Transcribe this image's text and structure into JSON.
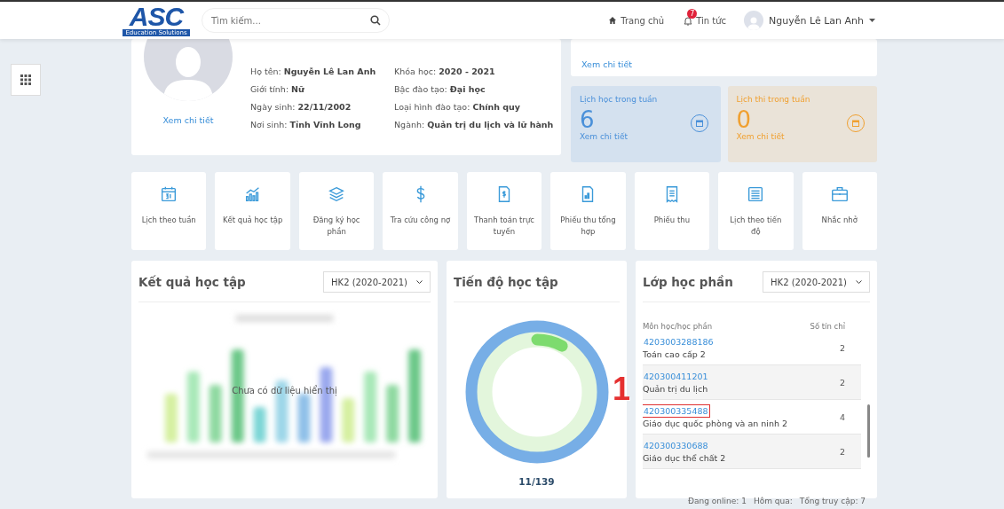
{
  "header": {
    "logo": {
      "text": "ASC",
      "tagline": "Education Solutions"
    },
    "search": {
      "placeholder": "Tìm kiếm..."
    },
    "nav": [
      {
        "label": "Trang chủ",
        "kind": "home"
      },
      {
        "label": "Tin tức",
        "kind": "bell",
        "badge": "7"
      }
    ],
    "user": {
      "name": "Nguyễn Lê Lan Anh"
    }
  },
  "profile": {
    "link": "Xem chi tiết",
    "columns": [
      [
        "Họ tên: **Nguyễn Lê Lan Anh**",
        "Giới tính: **Nữ**",
        "Ngày sinh: **22/11/2002**",
        "Nơi sinh: **Tỉnh Vĩnh Long**"
      ],
      [
        "Khóa học: **2020 - 2021**",
        "Bậc đào tạo: **Đại học**",
        "Loại hình đào tạo: **Chính quy**",
        "Ngành: **Quản trị du lịch và lữ hành**"
      ]
    ]
  },
  "top_card": {
    "link": "Xem chi tiết"
  },
  "stats": [
    {
      "label": "Lịch học trong tuần",
      "value": "6",
      "link": "Xem chi tiết",
      "color": "#4a90d9"
    },
    {
      "label": "Lịch thi trong tuần",
      "value": "0",
      "link": "Xem chi tiết",
      "color": "#f0a030"
    }
  ],
  "shortcuts": [
    "Lịch theo tuần",
    "Kết quả học tập",
    "Đăng ký học phần",
    "Tra cứu công nợ",
    "Thanh toán trực tuyến",
    "Phiếu thu tổng hợp",
    "Phiếu thu",
    "Lịch theo tiến độ",
    "Nhắc nhở"
  ],
  "results_panel": {
    "title": "Kết quả học tập",
    "select": "HK2 (2020-2021)",
    "empty_message": "Chưa có dữ liệu hiển thị"
  },
  "progress_panel": {
    "title": "Tiến độ học tập",
    "level": 0.079,
    "reading": "11/139"
  },
  "classes_panel": {
    "title": "Lớp học phần",
    "select": "HK2 (2020-2021)",
    "columns": [
      "Môn học/học phần",
      "Số tín chỉ"
    ],
    "rows": [
      {
        "code": "4203003288186",
        "name": "Toán cao cấp 2",
        "credits": "2",
        "highlighted": false
      },
      {
        "code": "420300411201",
        "name": "Quản trị du lịch",
        "credits": "2",
        "highlighted": false
      },
      {
        "code": "420300335488",
        "name": "Giáo dục quốc phòng và an ninh 2",
        "credits": "4",
        "highlighted": true
      },
      {
        "code": "420300330688",
        "name": "Giáo dục thể chất 2",
        "credits": "2",
        "highlighted": false
      }
    ],
    "callout": "1"
  },
  "footer": [
    "Đang online: 1",
    "Hôm qua:",
    "Tổng truy cập: 7"
  ]
}
